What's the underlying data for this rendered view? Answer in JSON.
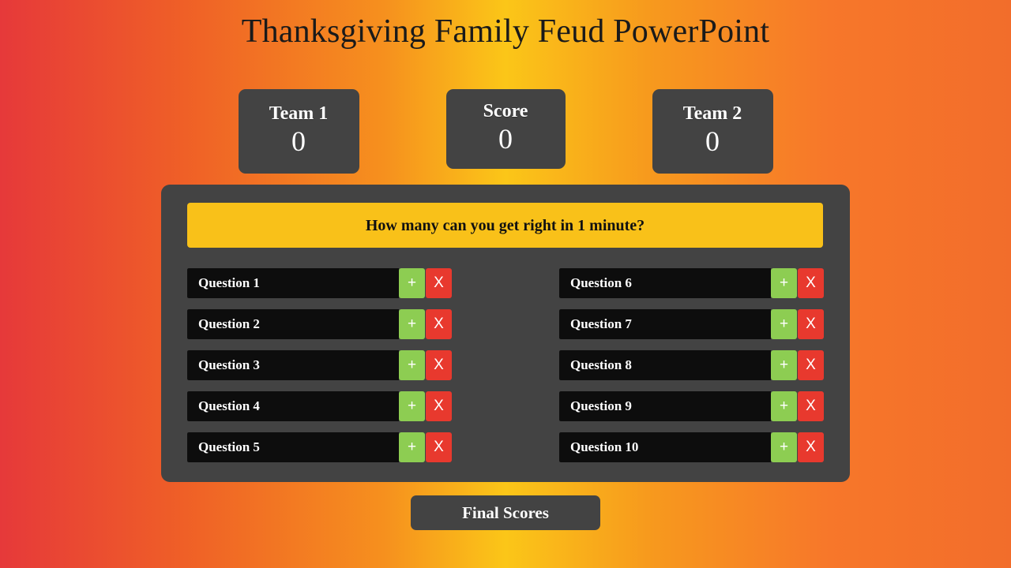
{
  "slide": {
    "title": "Thanksgiving Family Feud PowerPoint",
    "background": {
      "from": "#e6393a",
      "mid": "#fbc618",
      "to": "#f26d2b"
    }
  },
  "scoreboard": {
    "team1": {
      "label": "Team 1",
      "value": "0"
    },
    "center": {
      "label": "Score",
      "value": "0"
    },
    "team2": {
      "label": "Team 2",
      "value": "0"
    }
  },
  "panel": {
    "background_color": "#434343",
    "banner": {
      "text": "How many can you get right in 1 minute?",
      "background_color": "#f9c119",
      "text_color": "#111111"
    },
    "button_colors": {
      "add": "#8dcd52",
      "remove": "#e8392e"
    },
    "row_button_labels": {
      "add": "+",
      "remove": "X"
    },
    "left_column": [
      {
        "label": "Question 1"
      },
      {
        "label": "Question 2"
      },
      {
        "label": "Question 3"
      },
      {
        "label": "Question 4"
      },
      {
        "label": "Question 5"
      }
    ],
    "right_column": [
      {
        "label": "Question 6"
      },
      {
        "label": "Question 7"
      },
      {
        "label": "Question 8"
      },
      {
        "label": "Question 9"
      },
      {
        "label": "Question 10"
      }
    ]
  },
  "footer": {
    "final_scores_label": "Final Scores"
  }
}
